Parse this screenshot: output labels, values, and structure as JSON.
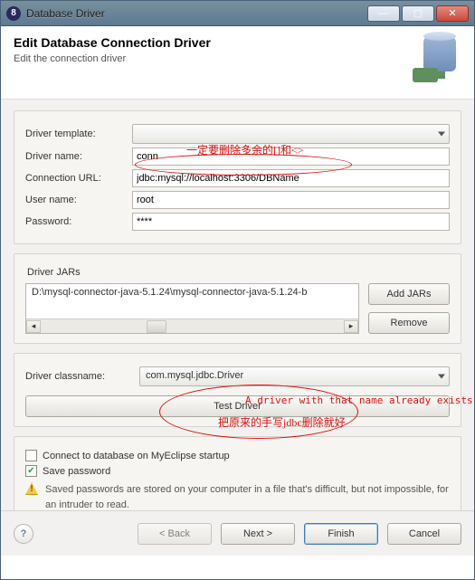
{
  "titlebar": {
    "title": "Database Driver"
  },
  "header": {
    "title": "Edit Database Connection Driver",
    "subtitle": "Edit the connection driver"
  },
  "form": {
    "template_label": "Driver template:",
    "template_value": "",
    "name_label": "Driver name:",
    "name_value": "conn",
    "url_label": "Connection URL:",
    "url_value": "jdbc:mysql://localhost:3306/DBName",
    "user_label": "User name:",
    "user_value": "root",
    "pass_label": "Password:",
    "pass_value": "****"
  },
  "jars": {
    "section": "Driver JARs",
    "items": [
      "D:\\mysql-connector-java-5.1.24\\mysql-connector-java-5.1.24-b"
    ],
    "add": "Add JARs",
    "remove": "Remove"
  },
  "classname": {
    "label": "Driver classname:",
    "value": "com.mysql.jdbc.Driver"
  },
  "test": "Test Driver",
  "checks": {
    "connect_startup": "Connect to database on MyEclipse startup",
    "save_password": "Save password"
  },
  "warning": "Saved passwords are stored on your computer in a file that's difficult, but not impossible, for an intruder to read.",
  "footer": {
    "back": "< Back",
    "next": "Next >",
    "finish": "Finish",
    "cancel": "Cancel"
  },
  "annotations": {
    "top": "一定要删除多余的[]和<>",
    "err": "A driver with that name already exists",
    "bottom": "把原来的手写jdbc删除就好"
  }
}
